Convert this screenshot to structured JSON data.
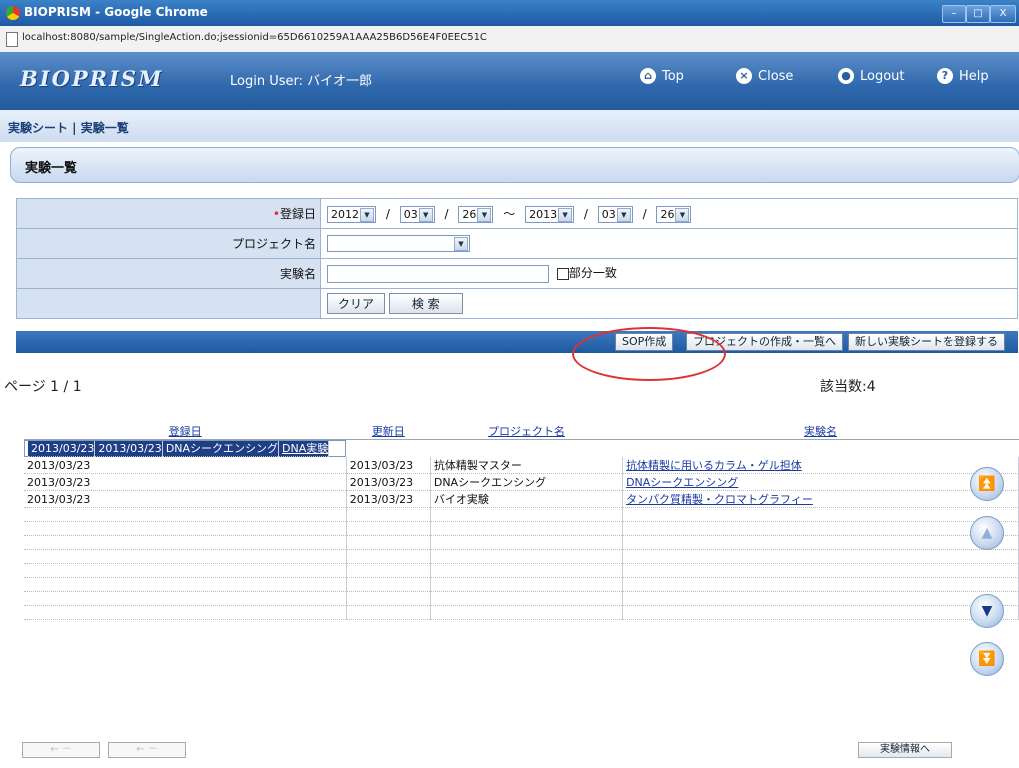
{
  "window": {
    "title": "BIOPRISM - Google Chrome",
    "minimize": "–",
    "maximize": "□",
    "close": "X"
  },
  "address": {
    "url": "localhost:8080/sample/SingleAction.do;jsessionid=65D6610259A1AAA25B6D56E4F0EEC51C"
  },
  "header": {
    "logo": "BIOPRISM",
    "login_user": "Login User: バイオ一郎",
    "nav": {
      "top": "Top",
      "close": "Close",
      "logout": "Logout",
      "help": "Help"
    }
  },
  "breadcrumb": "実験シート | 実験一覧",
  "page_title": "実験一覧",
  "search": {
    "date_label": "登録日",
    "required_mark": "•",
    "from": {
      "year": "2012",
      "month": "03",
      "day": "26"
    },
    "to": {
      "year": "2013",
      "month": "03",
      "day": "26"
    },
    "slash": "/",
    "tilde": "〜",
    "project_label": "プロジェクト名",
    "project_value": "",
    "name_label": "実験名",
    "name_value": "",
    "partial_match_label": "部分一致",
    "clear_button": "クリア",
    "search_button": "検 索"
  },
  "actions": {
    "sop": "SOP作成",
    "project_list": "プロジェクトの作成・一覧へ",
    "new_sheet": "新しい実験シートを登録する"
  },
  "pagination": {
    "page_text": "ページ 1 / 1",
    "count_text": "該当数:4"
  },
  "table": {
    "headers": [
      "登録日",
      "更新日",
      "プロジェクト名",
      "実験名"
    ],
    "rows": [
      {
        "registered": "2013/03/23",
        "updated": "2013/03/23",
        "project": "DNAシークエンシング",
        "name": "DNA実験",
        "selected": true
      },
      {
        "registered": "2013/03/23",
        "updated": "2013/03/23",
        "project": "抗体精製マスター",
        "name": "抗体精製に用いるカラム・ゲル担体",
        "selected": false
      },
      {
        "registered": "2013/03/23",
        "updated": "2013/03/23",
        "project": "DNAシークエンシング",
        "name": "DNAシークエンシング",
        "selected": false
      },
      {
        "registered": "2013/03/23",
        "updated": "2013/03/23",
        "project": "バイオ実験",
        "name": "タンパク質精製・クロマトグラフィー",
        "selected": false
      }
    ]
  },
  "scroll": {
    "first": "⏫",
    "prev": "▲",
    "next": "▼",
    "last": "⏬"
  },
  "footer": {
    "prev1": "← －",
    "prev2": "← －",
    "detail": "実験情報へ"
  }
}
